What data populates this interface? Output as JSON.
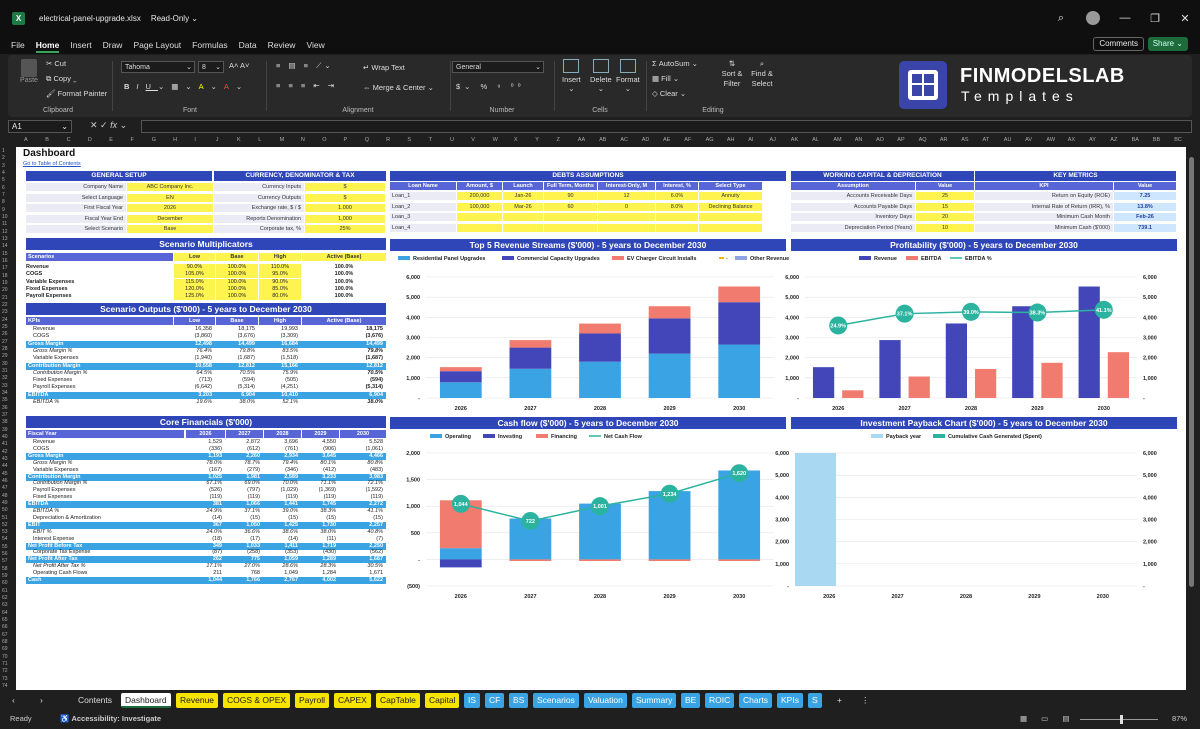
{
  "window": {
    "filename": "electrical-panel-upgrade.xlsx",
    "mode": "Read-Only"
  },
  "menu": [
    "File",
    "Home",
    "Insert",
    "Draw",
    "Page Layout",
    "Formulas",
    "Data",
    "Review",
    "View"
  ],
  "menu_active": "Home",
  "comments_label": "Comments",
  "share_label": "Share",
  "ribbon": {
    "paste": "Paste",
    "cut": "Cut",
    "copy": "Copy",
    "format_painter": "Format Painter",
    "clipboard": "Clipboard",
    "font_name": "Tahoma",
    "font_size": "8",
    "font_group": "Font",
    "wrap_text": "Wrap Text",
    "merge_center": "Merge & Center",
    "alignment": "Alignment",
    "number_format": "General",
    "number": "Number",
    "insert": "Insert",
    "delete": "Delete",
    "format": "Format",
    "cells": "Cells",
    "autosum": "AutoSum",
    "fill": "Fill",
    "clear": "Clear",
    "sort_filter": "Sort & Filter",
    "find_select": "Find & Select",
    "editing": "Editing"
  },
  "brand": {
    "name": "FINMODELSLAB",
    "sub": "Templates"
  },
  "formula": {
    "cell": "A1",
    "fx": "fx",
    "value": ""
  },
  "columns": [
    "A",
    "B",
    "C",
    "D",
    "E",
    "F",
    "G",
    "H",
    "I",
    "J",
    "K",
    "L",
    "M",
    "N",
    "O",
    "P",
    "Q",
    "R",
    "S",
    "T",
    "U",
    "V",
    "W",
    "X",
    "Y",
    "Z",
    "AA",
    "AB",
    "AC",
    "AD",
    "AE",
    "AF",
    "AG",
    "AH",
    "AI",
    "AJ",
    "AK",
    "AL",
    "AM",
    "AN",
    "AO",
    "AP",
    "AQ",
    "AR",
    "AS",
    "AT",
    "AU",
    "AV",
    "AW",
    "AX",
    "AY",
    "AZ",
    "BA",
    "BB",
    "BC"
  ],
  "sheet": {
    "title": "Dashboard",
    "link": "Go to Table of Contents",
    "general": {
      "header": "GENERAL SETUP",
      "rows": [
        [
          "Company Name",
          "ABC Company Inc."
        ],
        [
          "Select Language",
          "EN"
        ],
        [
          "First Fiscal Year",
          "2026"
        ],
        [
          "Fiscal Year End",
          "December"
        ],
        [
          "Select Scenario",
          "Base"
        ]
      ]
    },
    "currency": {
      "header": "CURRENCY, DENOMINATOR & TAX",
      "rows": [
        [
          "Currency Inputs",
          "$"
        ],
        [
          "Currency Outputs",
          "$"
        ],
        [
          "Exchange rate, $ / $",
          "1.000"
        ],
        [
          "Reports Denomination",
          "1,000"
        ],
        [
          "Corporate tax, %",
          "25%"
        ]
      ]
    },
    "debts": {
      "header": "DEBTS ASSUMPTIONS",
      "cols": [
        "Loan Name",
        "Amount, $",
        "Launch",
        "Full Term, Months",
        "Interest-Only, M",
        "Interest, %",
        "Select Type"
      ],
      "rows": [
        [
          "Loan_1",
          "200,000",
          "Jan-26",
          "90",
          "12",
          "6.0%",
          "Annuity"
        ],
        [
          "Loan_2",
          "100,000",
          "Mar-26",
          "60",
          "0",
          "8.0%",
          "Declining Balance"
        ],
        [
          "Loan_3",
          "",
          "",
          "",
          "",
          "",
          ""
        ],
        [
          "Loan_4",
          "",
          "",
          "",
          "",
          "",
          ""
        ]
      ]
    },
    "wc": {
      "header": "WORKING CAPITAL & DEPRECIATION",
      "cols": [
        "Assumption",
        "Value"
      ],
      "rows": [
        [
          "Accounts Receivable Days",
          "25"
        ],
        [
          "Accounts Payable Days",
          "15"
        ],
        [
          "Inventory Days",
          "20"
        ],
        [
          "Depreciation Period (Years)",
          "10"
        ]
      ]
    },
    "kpi": {
      "header": "KEY METRICS",
      "cols": [
        "KPI",
        "Value"
      ],
      "rows": [
        [
          "Return on Equity (ROE)",
          "7.25"
        ],
        [
          "Internal Rate of Return (IRR), %",
          "13.8%"
        ],
        [
          "Minimum Cash Month",
          "Feb-26"
        ],
        [
          "Minimum Cash ($'000)",
          "739.1"
        ]
      ]
    },
    "scen_mult": {
      "header": "Scenario Multiplicators",
      "cols": [
        "Scenarios",
        "Low",
        "Base",
        "High",
        "Active (Base)"
      ],
      "rows": [
        [
          "Revenue",
          "90.0%",
          "100.0%",
          "110.0%",
          "100.0%"
        ],
        [
          "COGS",
          "105.0%",
          "100.0%",
          "95.0%",
          "100.0%"
        ],
        [
          "Variable Expenses",
          "115.0%",
          "100.0%",
          "90.0%",
          "100.0%"
        ],
        [
          "Fixed Expenses",
          "120.0%",
          "100.0%",
          "85.0%",
          "100.0%"
        ],
        [
          "Payroll Expenses",
          "125.0%",
          "100.0%",
          "80.0%",
          "100.0%"
        ]
      ]
    },
    "scen_out": {
      "header": "Scenario Outputs ($'000) - 5 years to December 2030",
      "cols": [
        "KPIs",
        "Low",
        "Base",
        "High",
        "Active (Base)"
      ],
      "rows": [
        [
          "Revenue",
          "16,358",
          "18,175",
          "19,993",
          "18,175",
          "n"
        ],
        [
          "COGS",
          "(3,860)",
          "(3,676)",
          "(3,309)",
          "(3,676)",
          "n"
        ],
        [
          "Gross Margin",
          "12,498",
          "14,499",
          "16,684",
          "14,499",
          "h"
        ],
        [
          "Gross Margin %",
          "76.4%",
          "79.8%",
          "83.5%",
          "79.8%",
          "i"
        ],
        [
          "Variable Expenses",
          "(1,940)",
          "(1,687)",
          "(1,518)",
          "(1,687)",
          "n"
        ],
        [
          "Contribution Margin",
          "10,558",
          "12,812",
          "15,166",
          "12,812",
          "h"
        ],
        [
          "Contribution Margin %",
          "64.5%",
          "70.5%",
          "75.9%",
          "70.5%",
          "i"
        ],
        [
          "Fixed Expenses",
          "(713)",
          "(594)",
          "(505)",
          "(594)",
          "n"
        ],
        [
          "Payroll Expenses",
          "(6,642)",
          "(5,314)",
          "(4,251)",
          "(5,314)",
          "n"
        ],
        [
          "EBITDA",
          "3,203",
          "6,904",
          "10,410",
          "6,904",
          "h"
        ],
        [
          "EBITDA %",
          "19.6%",
          "38.0%",
          "52.1%",
          "38.0%",
          "i"
        ]
      ]
    },
    "core": {
      "header": "Core Financials ($'000)",
      "cols": [
        "Fiscal Year",
        "2026",
        "2027",
        "2028",
        "2029",
        "2030"
      ],
      "rows": [
        [
          "Revenue",
          "1,529",
          "2,872",
          "3,696",
          "4,550",
          "5,528",
          "n"
        ],
        [
          "COGS",
          "(336)",
          "(612)",
          "(761)",
          "(906)",
          "(1,061)",
          "n"
        ],
        [
          "Gross Margin",
          "1,193",
          "2,260",
          "2,934",
          "3,645",
          "4,466",
          "h"
        ],
        [
          "Gross Margin %",
          "78.0%",
          "78.7%",
          "79.4%",
          "80.1%",
          "80.8%",
          "i"
        ],
        [
          "Variable Expenses",
          "(167)",
          "(279)",
          "(346)",
          "(412)",
          "(483)",
          "n"
        ],
        [
          "Contribution Margin",
          "1,025",
          "1,981",
          "2,589",
          "3,233",
          "3,983",
          "h"
        ],
        [
          "Contribution Margin %",
          "67.1%",
          "69.0%",
          "70.0%",
          "71.1%",
          "72.1%",
          "i"
        ],
        [
          "Payroll Expenses",
          "(526)",
          "(797)",
          "(1,029)",
          "(1,369)",
          "(1,592)",
          "n"
        ],
        [
          "Fixed Expenses",
          "(119)",
          "(119)",
          "(119)",
          "(119)",
          "(119)",
          "n"
        ],
        [
          "EBITDA",
          "381",
          "1,066",
          "1,441",
          "1,745",
          "2,272",
          "h"
        ],
        [
          "EBITDA %",
          "24.9%",
          "37.1%",
          "39.0%",
          "38.3%",
          "41.1%",
          "i"
        ],
        [
          "Depreciation & Amortization",
          "(14)",
          "(15)",
          "(15)",
          "(15)",
          "(15)",
          "n"
        ],
        [
          "EBIT",
          "367",
          "1,050",
          "1,425",
          "1,730",
          "2,257",
          "h"
        ],
        [
          "EBIT %",
          "24.0%",
          "36.6%",
          "38.6%",
          "38.0%",
          "40.8%",
          "i"
        ],
        [
          "Interest Expense",
          "(18)",
          "(17)",
          "(14)",
          "(11)",
          "(7)",
          "n"
        ],
        [
          "Net Profit Before Tax",
          "349",
          "1,033",
          "1,411",
          "1,719",
          "2,250",
          "h"
        ],
        [
          "Corporate Tax Expense",
          "(87)",
          "(258)",
          "(353)",
          "(430)",
          "(562)",
          "n"
        ],
        [
          "Net Profit After Tax",
          "262",
          "775",
          "1,059",
          "1,289",
          "1,687",
          "h"
        ],
        [
          "Net Profit After Tax %",
          "17.1%",
          "27.0%",
          "28.6%",
          "28.3%",
          "30.5%",
          "i"
        ],
        [
          "Operating Cash Flows",
          "211",
          "768",
          "1,049",
          "1,284",
          "1,671",
          "n"
        ],
        [
          "Cash",
          "1,044",
          "1,766",
          "2,767",
          "4,002",
          "5,622",
          "h"
        ]
      ]
    }
  },
  "chart_data": [
    {
      "type": "bar",
      "title": "Top 5 Revenue Streams ($'000) - 5 years to December 2030",
      "stacked": true,
      "categories": [
        "2026",
        "2027",
        "2028",
        "2029",
        "2030"
      ],
      "ylim": [
        0,
        6000
      ],
      "yticks": [
        "-",
        "1,000",
        "2,000",
        "3,000",
        "4,000",
        "5,000",
        "6,000"
      ],
      "series": [
        {
          "name": "Residential Panel Upgrades",
          "color": "#3aa3e3",
          "values": [
            780,
            1450,
            1800,
            2200,
            2650
          ]
        },
        {
          "name": "Commercial Capacity Upgrades",
          "color": "#4346b8",
          "values": [
            550,
            1050,
            1400,
            1750,
            2100
          ]
        },
        {
          "name": "EV Charger Circuit Installs",
          "color": "#f07b6e",
          "values": [
            200,
            370,
            490,
            600,
            780
          ]
        },
        {
          "name": "",
          "color": "#f5b800",
          "values": [
            0,
            0,
            0,
            0,
            0
          ]
        },
        {
          "name": "Other Revenue",
          "color": "#8fa4e0",
          "values": [
            0,
            0,
            0,
            0,
            0
          ]
        }
      ]
    },
    {
      "type": "bar",
      "title": "Profitability ($'000) - 5 years to December 2030",
      "categories": [
        "2026",
        "2027",
        "2028",
        "2029",
        "2030"
      ],
      "ylim": [
        0,
        6000
      ],
      "yticks": [
        "-",
        "1,000",
        "2,000",
        "3,000",
        "4,000",
        "5,000",
        "6,000"
      ],
      "series": [
        {
          "name": "Revenue",
          "color": "#4346b8",
          "values": [
            1529,
            2872,
            3696,
            4550,
            5528
          ]
        },
        {
          "name": "EBITDA",
          "color": "#f07b6e",
          "values": [
            381,
            1066,
            1441,
            1745,
            2272
          ]
        },
        {
          "name": "EBITDA %",
          "color": "#2bb3a0",
          "type": "line",
          "values": [
            24.9,
            37.1,
            39.0,
            38.3,
            41.1
          ],
          "labels": [
            "24.9%",
            "37.1%",
            "39.0%",
            "38.3%",
            "41.1%"
          ]
        }
      ]
    },
    {
      "type": "bar",
      "title": "Cash flow ($'000) - 5 years to December 2030",
      "stacked": true,
      "categories": [
        "2026",
        "2027",
        "2028",
        "2029",
        "2030"
      ],
      "ylim": [
        -500,
        2000
      ],
      "yticks": [
        "(500)",
        "-",
        "500",
        "1,000",
        "1,500",
        "2,000"
      ],
      "series": [
        {
          "name": "Operating",
          "color": "#3aa3e3",
          "values": [
            211,
            768,
            1049,
            1284,
            1671
          ]
        },
        {
          "name": "Investing",
          "color": "#4346b8",
          "values": [
            -150,
            0,
            0,
            0,
            0
          ]
        },
        {
          "name": "Financing",
          "color": "#f07b6e",
          "values": [
            900,
            -30,
            -30,
            -30,
            -30
          ]
        },
        {
          "name": "Net Cash Flow",
          "color": "#2bb3a0",
          "type": "line",
          "values": [
            1044,
            722,
            1001,
            1234,
            1620
          ],
          "labels": [
            "1,044",
            "722",
            "1,001",
            "1,234",
            "1,620"
          ]
        }
      ]
    },
    {
      "type": "line",
      "title": "Investment Payback Chart ($'000) - 5 years to December 2030",
      "categories": [
        "2026",
        "2027",
        "2028",
        "2029",
        "2030"
      ],
      "ylim": [
        0,
        6000
      ],
      "yticks": [
        "-",
        "1,000",
        "2,000",
        "3,000",
        "4,000",
        "5,000",
        "6,000"
      ],
      "series": [
        {
          "name": "Payback year",
          "color": "#a9d8f2",
          "type": "bar",
          "values": [
            6000,
            0,
            0,
            0,
            0
          ]
        },
        {
          "name": "Cumulative Cash Generated (Spent)",
          "color": "#2bb3a0",
          "values": [
            0,
            750,
            2000,
            3300,
            5000
          ]
        }
      ]
    }
  ],
  "tabs": [
    {
      "label": "Contents",
      "style": "g"
    },
    {
      "label": "Dashboard",
      "style": "act"
    },
    {
      "label": "Revenue",
      "style": "y"
    },
    {
      "label": "COGS & OPEX",
      "style": "y"
    },
    {
      "label": "Payroll",
      "style": "y"
    },
    {
      "label": "CAPEX",
      "style": "y"
    },
    {
      "label": "CapTable",
      "style": "y"
    },
    {
      "label": "Capital",
      "style": "y"
    },
    {
      "label": "IS",
      "style": "b"
    },
    {
      "label": "CF",
      "style": "b"
    },
    {
      "label": "BS",
      "style": "b"
    },
    {
      "label": "Scenarios",
      "style": "b"
    },
    {
      "label": "Valuation",
      "style": "b"
    },
    {
      "label": "Summary",
      "style": "b"
    },
    {
      "label": "BE",
      "style": "b"
    },
    {
      "label": "ROIC",
      "style": "b"
    },
    {
      "label": "Charts",
      "style": "b"
    },
    {
      "label": "KPIs",
      "style": "b"
    },
    {
      "label": "S",
      "style": "b"
    }
  ],
  "status": {
    "ready": "Ready",
    "accessibility": "Accessibility: Investigate",
    "zoom": "87%"
  }
}
